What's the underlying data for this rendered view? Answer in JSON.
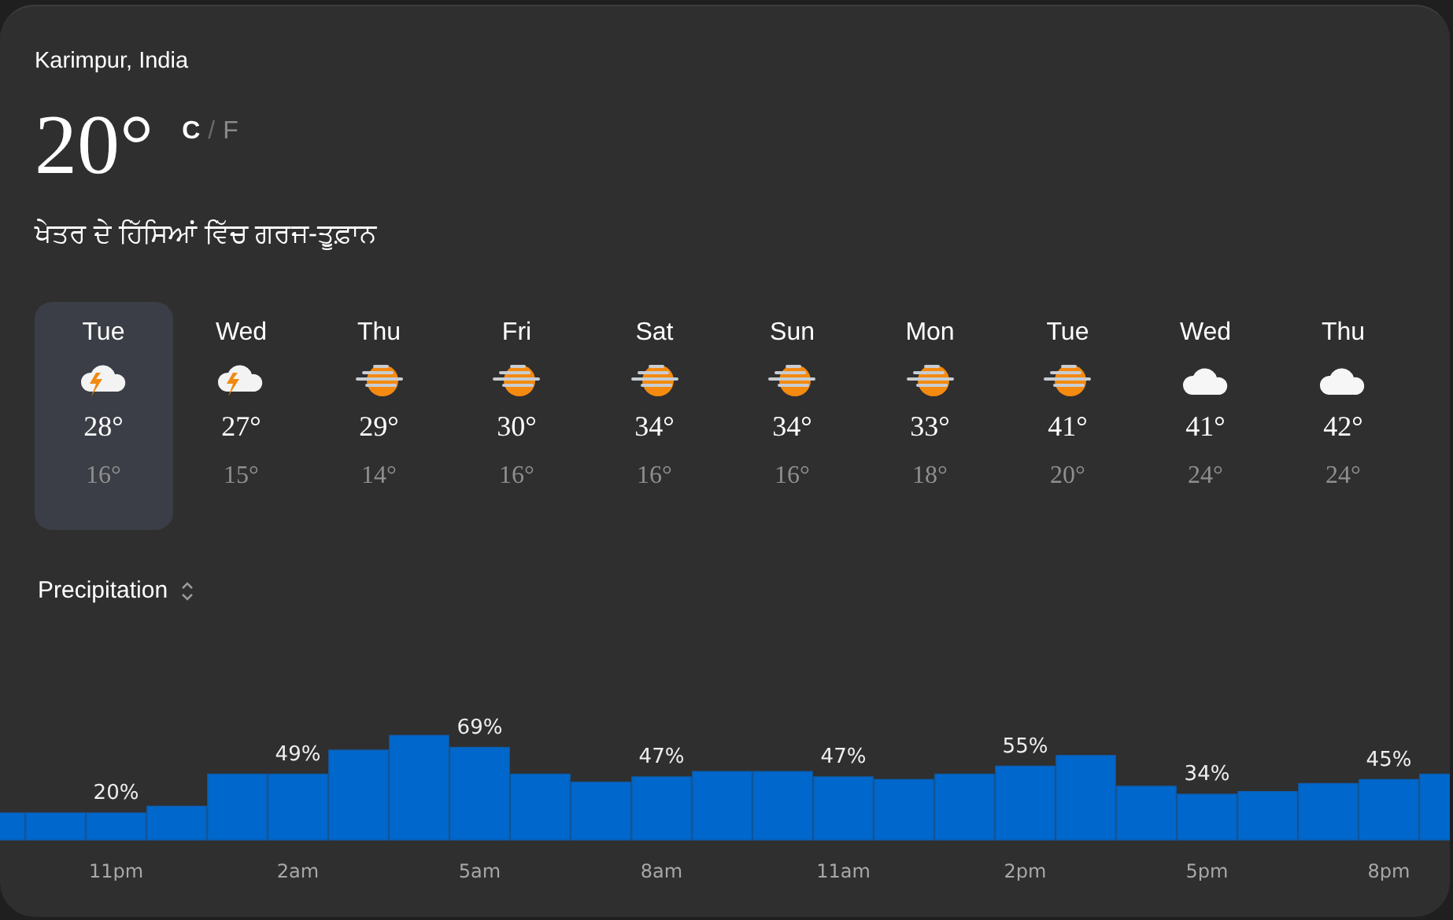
{
  "location": "Karimpur, India",
  "current": {
    "temperature": "20°",
    "units": [
      {
        "label": "C",
        "selected": true
      },
      {
        "label": "F",
        "selected": false
      }
    ],
    "separator": "/",
    "condition": "ਖੇਤਰ ਦੇ ਹਿੱਸਿਆਂ ਵਿੱਚ ਗਰਜ-ਤੂਫ਼ਾਨ"
  },
  "days": [
    {
      "day": "Tue",
      "kind": "thunder",
      "high": "28°",
      "low": "16°",
      "selected": true
    },
    {
      "day": "Wed",
      "kind": "thunder",
      "high": "27°",
      "low": "15°",
      "selected": false
    },
    {
      "day": "Thu",
      "kind": "haze",
      "high": "29°",
      "low": "14°",
      "selected": false
    },
    {
      "day": "Fri",
      "kind": "haze",
      "high": "30°",
      "low": "16°",
      "selected": false
    },
    {
      "day": "Sat",
      "kind": "haze",
      "high": "34°",
      "low": "16°",
      "selected": false
    },
    {
      "day": "Sun",
      "kind": "haze",
      "high": "34°",
      "low": "16°",
      "selected": false
    },
    {
      "day": "Mon",
      "kind": "haze",
      "high": "33°",
      "low": "18°",
      "selected": false
    },
    {
      "day": "Tue",
      "kind": "haze",
      "high": "41°",
      "low": "20°",
      "selected": false
    },
    {
      "day": "Wed",
      "kind": "cloud",
      "high": "41°",
      "low": "24°",
      "selected": false
    },
    {
      "day": "Thu",
      "kind": "cloud",
      "high": "42°",
      "low": "24°",
      "selected": false
    }
  ],
  "chart_selector": {
    "label": "Precipitation"
  },
  "chart": {
    "chart_data": {
      "type": "bar",
      "categories": [
        null,
        null,
        "11pm",
        null,
        null,
        "2am",
        null,
        null,
        "5am",
        null,
        null,
        "8am",
        null,
        null,
        "11am",
        null,
        null,
        "2pm",
        null,
        null,
        "5pm",
        null,
        null,
        "8pm",
        null
      ],
      "values": [
        20,
        20,
        20,
        25,
        49,
        49,
        67,
        78,
        69,
        49,
        43,
        47,
        51,
        51,
        47,
        45,
        49,
        55,
        63,
        40,
        34,
        36,
        42,
        45,
        49
      ],
      "value_labels": [
        null,
        null,
        "20%",
        null,
        null,
        "49%",
        null,
        null,
        "69%",
        null,
        null,
        "47%",
        null,
        null,
        "47%",
        null,
        null,
        "55%",
        null,
        null,
        "34%",
        null,
        null,
        "45%",
        null
      ],
      "data_labels": true
    }
  }
}
